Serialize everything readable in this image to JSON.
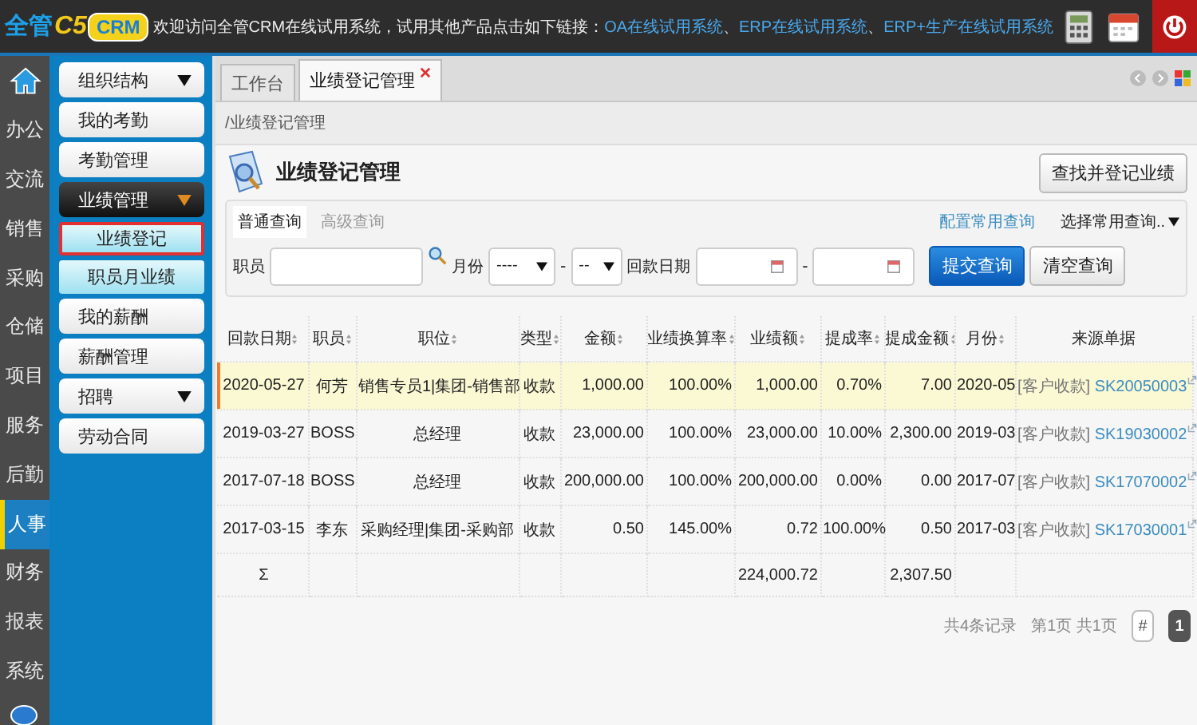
{
  "header": {
    "logo": {
      "brand": "全管",
      "version": "C5",
      "product": "CRM"
    },
    "welcome": "欢迎访问全管CRM在线试用系统，试用其他产品点击如下链接：",
    "links": [
      "OA在线试用系统",
      "ERP在线试用系统",
      "ERP+生产在线试用系统"
    ],
    "separator": "、"
  },
  "rail": [
    {
      "label": "办公",
      "selected": false
    },
    {
      "label": "交流",
      "selected": false
    },
    {
      "label": "销售",
      "selected": false
    },
    {
      "label": "采购",
      "selected": false
    },
    {
      "label": "仓储",
      "selected": false
    },
    {
      "label": "项目",
      "selected": false
    },
    {
      "label": "服务",
      "selected": false
    },
    {
      "label": "后勤",
      "selected": false
    },
    {
      "label": "人事",
      "selected": true
    },
    {
      "label": "财务",
      "selected": false
    },
    {
      "label": "报表",
      "selected": false
    },
    {
      "label": "系统",
      "selected": false
    }
  ],
  "menu": [
    {
      "label": "组织结构",
      "kind": "group",
      "expanded": false
    },
    {
      "label": "我的考勤",
      "kind": "item"
    },
    {
      "label": "考勤管理",
      "kind": "item"
    },
    {
      "label": "业绩管理",
      "kind": "group",
      "expanded": true,
      "children": [
        {
          "label": "业绩登记",
          "selected": true
        },
        {
          "label": "职员月业绩",
          "selected": false
        }
      ]
    },
    {
      "label": "我的薪酬",
      "kind": "item"
    },
    {
      "label": "薪酬管理",
      "kind": "item"
    },
    {
      "label": "招聘",
      "kind": "group",
      "expanded": false
    },
    {
      "label": "劳动合同",
      "kind": "item"
    }
  ],
  "tabs": [
    {
      "label": "工作台",
      "selected": false,
      "closable": false
    },
    {
      "label": "业绩登记管理",
      "selected": true,
      "closable": true
    }
  ],
  "breadcrumb": "/业绩登记管理",
  "page_title": "业绩登记管理",
  "find_button": "查找并登记业绩",
  "query_tabs": [
    {
      "label": "普通查询",
      "selected": true
    },
    {
      "label": "高级查询",
      "selected": false
    }
  ],
  "config_link": "配置常用查询",
  "saved_query": "选择常用查询..",
  "filters": {
    "employee_label": "职员",
    "month_label": "月份",
    "year_value": "----",
    "month_value": "--",
    "date_label": "回款日期",
    "range_separator": "-",
    "month_separator": "-"
  },
  "submit_button": "提交查询",
  "clear_button": "清空查询",
  "table": {
    "columns": [
      {
        "label": "回款日期",
        "sortable": true
      },
      {
        "label": "职员",
        "sortable": true
      },
      {
        "label": "职位",
        "sortable": true
      },
      {
        "label": "类型",
        "sortable": true
      },
      {
        "label": "金额",
        "sortable": true
      },
      {
        "label": "业绩换算率",
        "sortable": true
      },
      {
        "label": "业绩额",
        "sortable": true
      },
      {
        "label": "提成率",
        "sortable": true
      },
      {
        "label": "提成金额",
        "sortable": true
      },
      {
        "label": "月份",
        "sortable": true
      },
      {
        "label": "来源单据",
        "sortable": false
      }
    ],
    "rows": [
      {
        "selected": true,
        "cells": [
          "2020-05-27",
          "何芳",
          "销售专员1|集团-销售部",
          "收款",
          "1,000.00",
          "100.00%",
          "1,000.00",
          "0.70%",
          "7.00",
          "2020-05"
        ],
        "source_type": "[客户收款]",
        "source_no": "SK20050003"
      },
      {
        "selected": false,
        "cells": [
          "2019-03-27",
          "BOSS",
          "总经理",
          "收款",
          "23,000.00",
          "100.00%",
          "23,000.00",
          "10.00%",
          "2,300.00",
          "2019-03"
        ],
        "source_type": "[客户收款]",
        "source_no": "SK19030002"
      },
      {
        "selected": false,
        "cells": [
          "2017-07-18",
          "BOSS",
          "总经理",
          "收款",
          "200,000.00",
          "100.00%",
          "200,000.00",
          "0.00%",
          "0.00",
          "2017-07"
        ],
        "source_type": "[客户收款]",
        "source_no": "SK17070002"
      },
      {
        "selected": false,
        "cells": [
          "2017-03-15",
          "李东",
          "采购经理|集团-采购部",
          "收款",
          "0.50",
          "145.00%",
          "0.72",
          "100.00%",
          "0.50",
          "2017-03"
        ],
        "source_type": "[客户收款]",
        "source_no": "SK17030001"
      }
    ],
    "totals": {
      "label": "Σ",
      "performance": "224,000.72",
      "commission": "2,307.50"
    }
  },
  "pagination": {
    "records": "共4条记录",
    "pages": "第1页 共1页",
    "jump": "#",
    "pages_list": [
      {
        "label": "1",
        "selected": true
      }
    ]
  }
}
